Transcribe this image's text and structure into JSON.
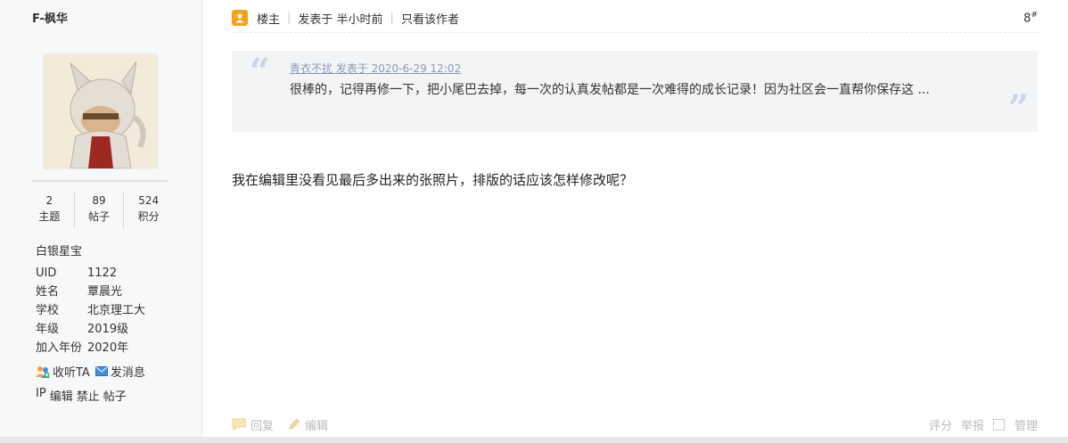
{
  "author": {
    "username": "F-枫华",
    "stats": [
      {
        "num": "2",
        "label": "主题"
      },
      {
        "num": "89",
        "label": "帖子"
      },
      {
        "num": "524",
        "label": "积分"
      }
    ],
    "honor": "白银星宝",
    "info": [
      {
        "key": "UID",
        "value": "1122"
      },
      {
        "key": "姓名",
        "value": "覃晨光"
      },
      {
        "key": "学校",
        "value": "北京理工大"
      },
      {
        "key": "年级",
        "value": "2019级"
      },
      {
        "key": "加入年份",
        "value": "2020年"
      }
    ],
    "follow_label": "收听TA",
    "message_label": "发消息",
    "admin": [
      "IP",
      "编辑",
      "禁止",
      "帖子"
    ]
  },
  "post": {
    "owner_label": "楼主",
    "time": "发表于 半小时前",
    "only_author": "只看该作者",
    "floor": "8",
    "floor_mark": "#",
    "quote": {
      "meta": "青衣不扰 发表于 2020-6-29 12:02",
      "text": "很棒的，记得再修一下，把小尾巴去掉，每一次的认真发帖都是一次难得的成长记录！因为社区会一直帮你保存这 ..."
    },
    "content": "我在编辑里没看见最后多出来的张照片，排版的话应该怎样修改呢？"
  },
  "footer": {
    "reply": "回复",
    "edit": "编辑",
    "rate": "评分",
    "report": "举报",
    "manage": "管理"
  },
  "colors": {
    "accent": "#f3a31a",
    "quote_meta": "#8a9bb5",
    "quote_bg": "#f3f4f6"
  }
}
